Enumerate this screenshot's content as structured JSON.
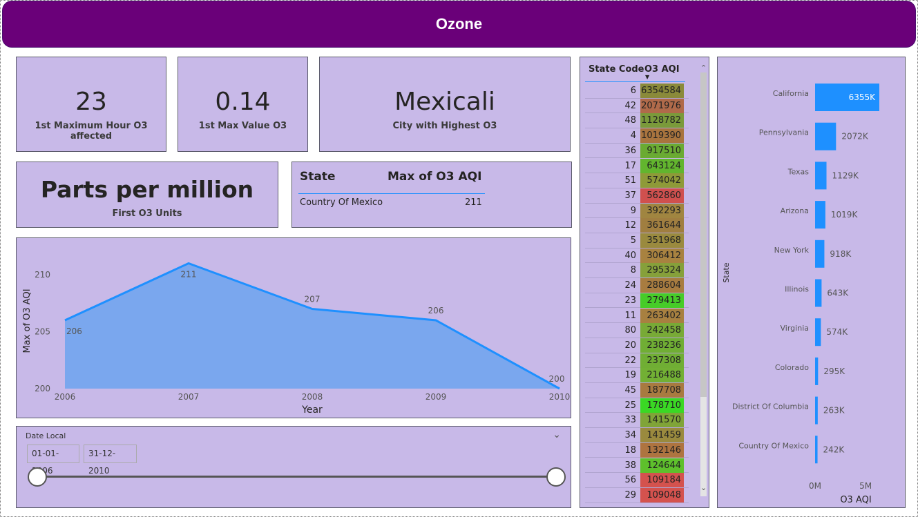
{
  "header": {
    "title": "Ozone"
  },
  "kpis": [
    {
      "value": "23",
      "label": "1st Maximum Hour O3 affected"
    },
    {
      "value": "0.14",
      "label": "1st Max Value O3"
    },
    {
      "value": "Mexicali",
      "label": "City with Highest O3"
    },
    {
      "value": "Parts per million",
      "label": "First O3 Units"
    }
  ],
  "state_table": {
    "headers": [
      "State",
      "Max of O3 AQI"
    ],
    "rows": [
      {
        "state": "Country Of Mexico",
        "value": "211"
      }
    ]
  },
  "slicer": {
    "title": "Date Local",
    "start": "01-01-2006",
    "end": "31-12-2010",
    "range_fraction": [
      0,
      1
    ]
  },
  "matrix": {
    "headers": [
      "State Code",
      "O3 AQI"
    ],
    "rows": [
      {
        "code": "6",
        "aqi": "6354584",
        "color": "#8a8a3a"
      },
      {
        "code": "42",
        "aqi": "2071976",
        "color": "#b06a4a"
      },
      {
        "code": "48",
        "aqi": "1128782",
        "color": "#7a9a3a"
      },
      {
        "code": "4",
        "aqi": "1019390",
        "color": "#a9743e"
      },
      {
        "code": "36",
        "aqi": "917510",
        "color": "#6aab32"
      },
      {
        "code": "17",
        "aqi": "643124",
        "color": "#62b52e"
      },
      {
        "code": "51",
        "aqi": "574042",
        "color": "#8e9a38"
      },
      {
        "code": "37",
        "aqi": "562860",
        "color": "#d0504e"
      },
      {
        "code": "9",
        "aqi": "392293",
        "color": "#a08540"
      },
      {
        "code": "12",
        "aqi": "361644",
        "color": "#a07e40"
      },
      {
        "code": "5",
        "aqi": "351968",
        "color": "#9a8a3e"
      },
      {
        "code": "40",
        "aqi": "306412",
        "color": "#a88240"
      },
      {
        "code": "8",
        "aqi": "295324",
        "color": "#86a03a"
      },
      {
        "code": "24",
        "aqi": "288604",
        "color": "#a87c40"
      },
      {
        "code": "23",
        "aqi": "279413",
        "color": "#46cc28"
      },
      {
        "code": "11",
        "aqi": "263402",
        "color": "#a88040"
      },
      {
        "code": "80",
        "aqi": "242458",
        "color": "#78aa36"
      },
      {
        "code": "20",
        "aqi": "238236",
        "color": "#70ae34"
      },
      {
        "code": "22",
        "aqi": "237308",
        "color": "#70ae34"
      },
      {
        "code": "19",
        "aqi": "216488",
        "color": "#72b034"
      },
      {
        "code": "45",
        "aqi": "187708",
        "color": "#a87a40"
      },
      {
        "code": "25",
        "aqi": "178710",
        "color": "#3ad824"
      },
      {
        "code": "33",
        "aqi": "141570",
        "color": "#80a438"
      },
      {
        "code": "34",
        "aqi": "141459",
        "color": "#9a8a3e"
      },
      {
        "code": "18",
        "aqi": "132146",
        "color": "#ae7440"
      },
      {
        "code": "38",
        "aqi": "124644",
        "color": "#5ec02c"
      },
      {
        "code": "56",
        "aqi": "109184",
        "color": "#d4524e"
      },
      {
        "code": "29",
        "aqi": "109048",
        "color": "#d4524e"
      }
    ]
  },
  "chart_data": [
    {
      "type": "area",
      "title": "",
      "xlabel": "Year",
      "ylabel": "Max of O3 AQI",
      "x": [
        2006,
        2007,
        2008,
        2009,
        2010
      ],
      "values": [
        206,
        211,
        207,
        206,
        200
      ],
      "data_labels": [
        "206",
        "211",
        "207",
        "206",
        "200"
      ],
      "ylim": [
        200,
        212
      ],
      "yticks": [
        "200",
        "205",
        "210"
      ],
      "xticks": [
        "2006",
        "2007",
        "2008",
        "2009",
        "2010"
      ],
      "grid": false,
      "color": "#1e90ff"
    },
    {
      "type": "bar",
      "orientation": "horizontal",
      "xlabel": "O3 AQI",
      "ylabel": "State",
      "categories": [
        "California",
        "Pennsylvania",
        "Texas",
        "Arizona",
        "New York",
        "Illinois",
        "Virginia",
        "Colorado",
        "District Of Columbia",
        "Country Of Mexico"
      ],
      "values": [
        6355000,
        2072000,
        1129000,
        1019000,
        918000,
        643000,
        574000,
        295000,
        263000,
        242000
      ],
      "data_labels": [
        "6355K",
        "2072K",
        "1129K",
        "1019K",
        "918K",
        "643K",
        "574K",
        "295K",
        "263K",
        "242K"
      ],
      "xlim": [
        0,
        6355000
      ],
      "xticks": [
        "0M",
        "5M"
      ],
      "grid": false,
      "color": "#1e90ff"
    }
  ]
}
